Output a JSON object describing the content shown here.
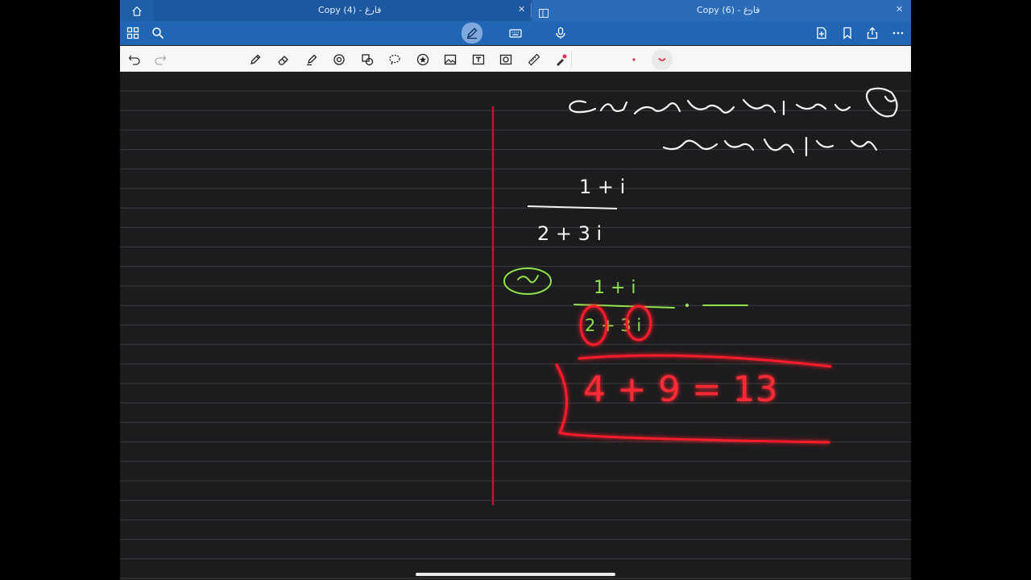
{
  "tabs": [
    {
      "title": "Copy (4) - فارغ",
      "active": false
    },
    {
      "title": "Copy (6) - فارغ",
      "active": true
    }
  ],
  "icons": {
    "home": "home-icon",
    "grid": "grid-icon",
    "search": "search-icon",
    "draw": "pen-draw-icon",
    "keyboard": "keyboard-icon",
    "dictate": "microphone-icon",
    "add_page": "add-page-icon",
    "bookmark": "bookmark-icon",
    "share": "share-icon",
    "more": "more-icon"
  },
  "pen_tray": {
    "tools": [
      "undo",
      "redo",
      "pen",
      "eraser",
      "highlighter",
      "lasso-shape",
      "shape-select",
      "lasso",
      "favorite-star",
      "image",
      "text-box",
      "scan",
      "ruler",
      "laser-pointer"
    ],
    "selected_color": "#e0314b"
  },
  "colors": {
    "ink_white": "#ffffff",
    "ink_green": "#8fe34b",
    "ink_red": "#ff1a2a",
    "margin_line": "#c8102e"
  },
  "handwriting": {
    "numerator": "1 + i",
    "denominator": "2 + 3 i",
    "result": "4 + 9 = 13"
  }
}
